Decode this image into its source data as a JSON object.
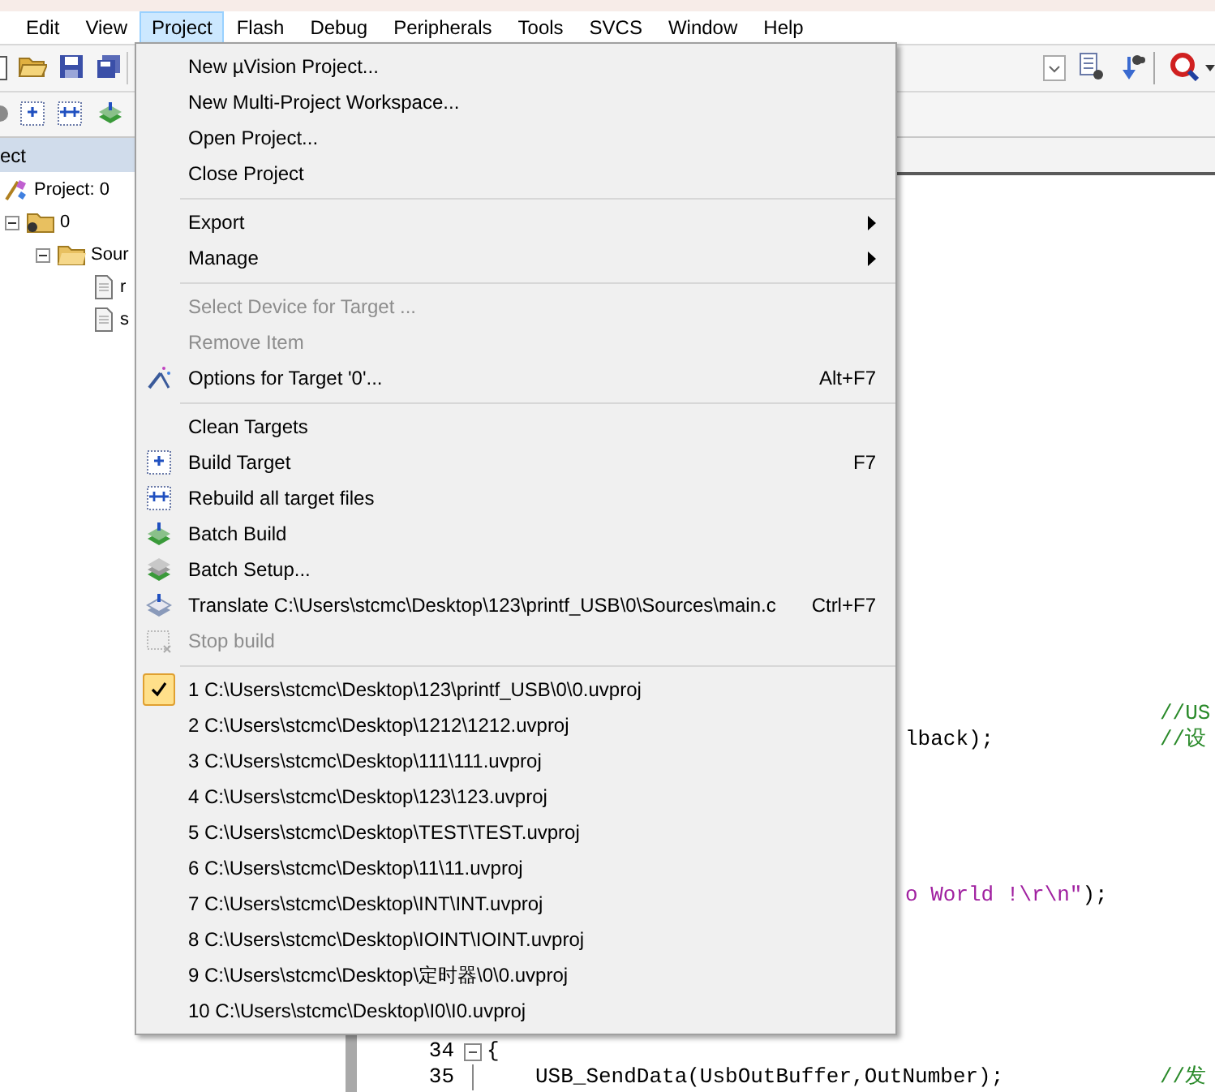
{
  "menubar": [
    {
      "label": "Edit",
      "selected": false
    },
    {
      "label": "View",
      "selected": false
    },
    {
      "label": "Project",
      "selected": true
    },
    {
      "label": "Flash",
      "selected": false
    },
    {
      "label": "Debug",
      "selected": false
    },
    {
      "label": "Peripherals",
      "selected": false
    },
    {
      "label": "Tools",
      "selected": false
    },
    {
      "label": "SVCS",
      "selected": false
    },
    {
      "label": "Window",
      "selected": false
    },
    {
      "label": "Help",
      "selected": false
    }
  ],
  "project_panel": {
    "title": "ect",
    "tree": [
      {
        "label": "Project: 0",
        "kind": "project",
        "children": [
          {
            "label": "0",
            "kind": "target",
            "expanded": true,
            "children": [
              {
                "label": "Sour",
                "kind": "group",
                "expanded": true,
                "children": [
                  {
                    "label": "r",
                    "kind": "file"
                  },
                  {
                    "label": "s",
                    "kind": "file"
                  }
                ]
              }
            ]
          }
        ]
      }
    ]
  },
  "editor": {
    "lines": [
      {
        "kind": "partial",
        "comment": "//US"
      },
      {
        "kind": "partial",
        "code": "lback);",
        "comment": "//设"
      },
      {
        "kind": "blank"
      },
      {
        "kind": "blank"
      },
      {
        "kind": "blank"
      },
      {
        "kind": "blank"
      },
      {
        "kind": "blank"
      },
      {
        "kind": "partial",
        "string": "o World !\\r\\n\"",
        "code": ");"
      },
      {
        "kind": "blank"
      },
      {
        "kind": "blank"
      },
      {
        "kind": "blank"
      },
      {
        "kind": "blank"
      },
      {
        "kind": "blank"
      },
      {
        "kind": "full",
        "number": "34",
        "fold": true,
        "code": "{"
      },
      {
        "kind": "full",
        "number": "35",
        "fold": false,
        "code": "USB_SendData(UsbOutBuffer,OutNumber);",
        "comment": "//发"
      }
    ]
  },
  "menu": {
    "items": [
      {
        "kind": "item",
        "label": "New µVision Project...",
        "disabled": false
      },
      {
        "kind": "item",
        "label": "New Multi-Project Workspace...",
        "disabled": false
      },
      {
        "kind": "item",
        "label": "Open Project...",
        "disabled": false
      },
      {
        "kind": "item",
        "label": "Close Project",
        "disabled": false
      },
      {
        "kind": "separator"
      },
      {
        "kind": "submenu",
        "label": "Export",
        "disabled": false
      },
      {
        "kind": "submenu",
        "label": "Manage",
        "disabled": false
      },
      {
        "kind": "separator"
      },
      {
        "kind": "item",
        "label": "Select Device for Target ...",
        "disabled": true
      },
      {
        "kind": "item",
        "label": "Remove Item",
        "disabled": true
      },
      {
        "kind": "item",
        "label": "Options for Target '0'...",
        "shortcut": "Alt+F7",
        "disabled": false
      },
      {
        "kind": "separator"
      },
      {
        "kind": "item",
        "label": "Clean Targets",
        "disabled": false
      },
      {
        "kind": "item",
        "label": "Build Target",
        "shortcut": "F7",
        "disabled": false
      },
      {
        "kind": "item",
        "label": "Rebuild all target files",
        "disabled": false
      },
      {
        "kind": "item",
        "label": "Batch Build",
        "disabled": false
      },
      {
        "kind": "item",
        "label": "Batch Setup...",
        "disabled": false
      },
      {
        "kind": "item",
        "label": "Translate C:\\Users\\stcmc\\Desktop\\123\\printf_USB\\0\\Sources\\main.c",
        "shortcut": "Ctrl+F7",
        "disabled": false
      },
      {
        "kind": "item",
        "label": "Stop build",
        "disabled": true
      },
      {
        "kind": "separator"
      },
      {
        "kind": "recent",
        "label": "1 C:\\Users\\stcmc\\Desktop\\123\\printf_USB\\0\\0.uvproj",
        "checked": true
      },
      {
        "kind": "recent",
        "label": "2 C:\\Users\\stcmc\\Desktop\\1212\\1212.uvproj",
        "checked": false
      },
      {
        "kind": "recent",
        "label": "3 C:\\Users\\stcmc\\Desktop\\111\\111.uvproj",
        "checked": false
      },
      {
        "kind": "recent",
        "label": "4 C:\\Users\\stcmc\\Desktop\\123\\123.uvproj",
        "checked": false
      },
      {
        "kind": "recent",
        "label": "5 C:\\Users\\stcmc\\Desktop\\TEST\\TEST.uvproj",
        "checked": false
      },
      {
        "kind": "recent",
        "label": "6 C:\\Users\\stcmc\\Desktop\\11\\11.uvproj",
        "checked": false
      },
      {
        "kind": "recent",
        "label": "7 C:\\Users\\stcmc\\Desktop\\INT\\INT.uvproj",
        "checked": false
      },
      {
        "kind": "recent",
        "label": "8 C:\\Users\\stcmc\\Desktop\\IOINT\\IOINT.uvproj",
        "checked": false
      },
      {
        "kind": "recent",
        "label": "9 C:\\Users\\stcmc\\Desktop\\定时器\\0\\0.uvproj",
        "checked": false
      },
      {
        "kind": "recent",
        "label": "10 C:\\Users\\stcmc\\Desktop\\I0\\I0.uvproj",
        "checked": false
      }
    ]
  }
}
